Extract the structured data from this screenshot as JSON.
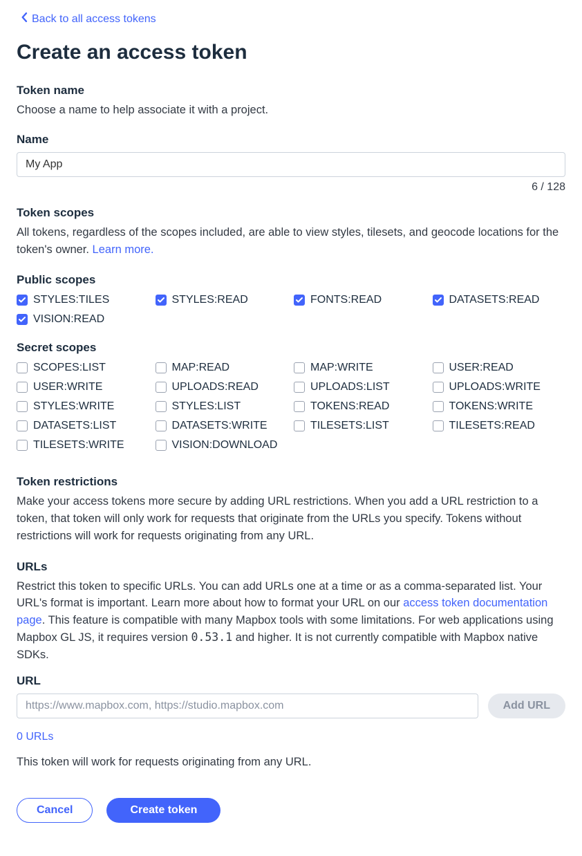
{
  "back_link": "Back to all access tokens",
  "page_title": "Create an access token",
  "token_name_section": {
    "title": "Token name",
    "desc": "Choose a name to help associate it with a project.",
    "field_label": "Name",
    "value": "My App",
    "char_count": "6 / 128"
  },
  "token_scopes_section": {
    "title": "Token scopes",
    "desc_prefix": "All tokens, regardless of the scopes included, are able to view styles, tilesets, and geocode locations for the token's owner. ",
    "learn_more": "Learn more."
  },
  "public_scopes": {
    "title": "Public scopes",
    "items": [
      {
        "label": "STYLES:TILES",
        "checked": true
      },
      {
        "label": "STYLES:READ",
        "checked": true
      },
      {
        "label": "FONTS:READ",
        "checked": true
      },
      {
        "label": "DATASETS:READ",
        "checked": true
      },
      {
        "label": "VISION:READ",
        "checked": true
      }
    ]
  },
  "secret_scopes": {
    "title": "Secret scopes",
    "items": [
      {
        "label": "SCOPES:LIST",
        "checked": false
      },
      {
        "label": "MAP:READ",
        "checked": false
      },
      {
        "label": "MAP:WRITE",
        "checked": false
      },
      {
        "label": "USER:READ",
        "checked": false
      },
      {
        "label": "USER:WRITE",
        "checked": false
      },
      {
        "label": "UPLOADS:READ",
        "checked": false
      },
      {
        "label": "UPLOADS:LIST",
        "checked": false
      },
      {
        "label": "UPLOADS:WRITE",
        "checked": false
      },
      {
        "label": "STYLES:WRITE",
        "checked": false
      },
      {
        "label": "STYLES:LIST",
        "checked": false
      },
      {
        "label": "TOKENS:READ",
        "checked": false
      },
      {
        "label": "TOKENS:WRITE",
        "checked": false
      },
      {
        "label": "DATASETS:LIST",
        "checked": false
      },
      {
        "label": "DATASETS:WRITE",
        "checked": false
      },
      {
        "label": "TILESETS:LIST",
        "checked": false
      },
      {
        "label": "TILESETS:READ",
        "checked": false
      },
      {
        "label": "TILESETS:WRITE",
        "checked": false
      },
      {
        "label": "VISION:DOWNLOAD",
        "checked": false
      }
    ]
  },
  "restrictions": {
    "title": "Token restrictions",
    "desc": "Make your access tokens more secure by adding URL restrictions. When you add a URL restriction to a token, that token will only work for requests that originate from the URLs you specify. Tokens without restrictions will work for requests originating from any URL."
  },
  "urls": {
    "title": "URLs",
    "desc_pre": "Restrict this token to specific URLs. You can add URLs one at a time or as a comma-separated list. Your URL's format is important. Learn more about how to format your URL on our ",
    "doc_link": "access token documentation page",
    "desc_mid": ". This feature is compatible with many Mapbox tools with some limitations. For web applications using Mapbox GL JS, it requires version ",
    "version": "0.53.1",
    "desc_post": " and higher. It is not currently compatible with Mapbox native SDKs.",
    "field_label": "URL",
    "placeholder": "https://www.mapbox.com, https://studio.mapbox.com",
    "add_button": "Add URL",
    "count": "0 URLs",
    "note": "This token will work for requests originating from any URL."
  },
  "buttons": {
    "cancel": "Cancel",
    "create": "Create token"
  }
}
